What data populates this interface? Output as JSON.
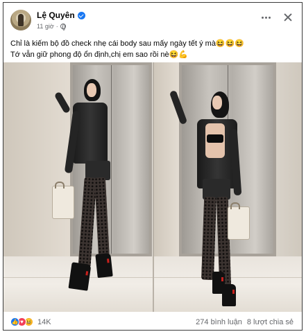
{
  "post": {
    "author": "Lệ Quyên",
    "time": "11 giờ",
    "separator": "·",
    "caption_line1": "Chỉ là kiếm bộ đồ check nhẹ cái body sau mấy ngày tết ý mà😆😆😆",
    "caption_line2": "Tớ vẫn giữ phong độ ổn định,chị em sao rồi nè😆💪"
  },
  "reactions": {
    "icons": [
      "like-icon",
      "love-icon",
      "haha-icon"
    ],
    "count": "14K"
  },
  "stats": {
    "comments": "274 bình luận",
    "shares": "8 lượt chia sẻ"
  },
  "colors": {
    "accent": "#1877f2",
    "love": "#f33e58",
    "haha": "#f7b125",
    "secondary_text": "#65676b"
  }
}
